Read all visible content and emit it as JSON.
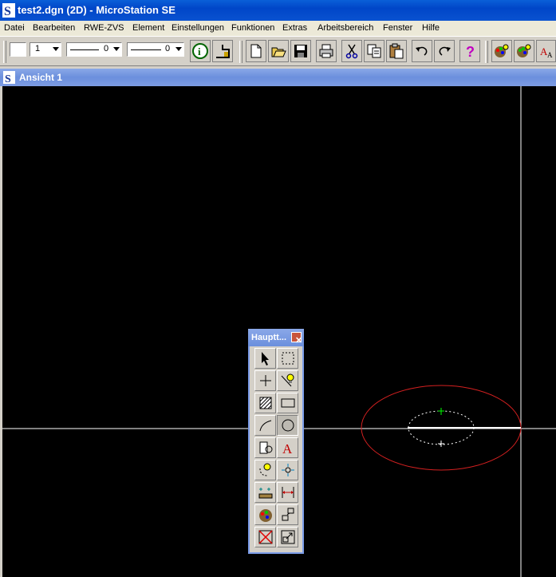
{
  "window": {
    "title": "test2.dgn (2D) - MicroStation SE"
  },
  "menu": [
    "Datei",
    "Bearbeiten",
    "RWE-ZVS",
    "Element",
    "Einstellungen",
    "Funktionen",
    "Extras",
    "Arbeitsbereich",
    "Fenster",
    "Hilfe"
  ],
  "toolbar": {
    "color_value": "",
    "level_value": "1",
    "style_value": "0",
    "weight_value": "0",
    "buttons": [
      "element-info-icon",
      "place-smartline-icon",
      "new-file-icon",
      "open-file-icon",
      "save-icon",
      "print-icon",
      "cut-icon",
      "copy-icon",
      "paste-icon",
      "undo-icon",
      "redo-icon",
      "help-icon",
      "view-attributes-icon",
      "rendering-icon",
      "text-style-icon"
    ]
  },
  "view": {
    "title": "Ansicht 1",
    "background": "#000000"
  },
  "palette": {
    "title": "Hauptt...",
    "close_glyph": "✕",
    "tools": [
      "element-selection-icon",
      "fence-icon",
      "point-icon",
      "accudraw-icon",
      "pattern-icon",
      "rectangle-icon",
      "arc-icon",
      "ellipse-icon",
      "drop-element-icon",
      "text-icon",
      "snap-icon",
      "tentative-icon",
      "measure-icon",
      "dimension-icon",
      "change-attributes-icon",
      "copy-move-icon",
      "delete-icon",
      "scale-icon"
    ],
    "active_tool": "ellipse-icon"
  },
  "drawing": {
    "ellipse_color": "#d42020",
    "circle_color": "#ffffff",
    "axis_color": "#ffffff"
  }
}
